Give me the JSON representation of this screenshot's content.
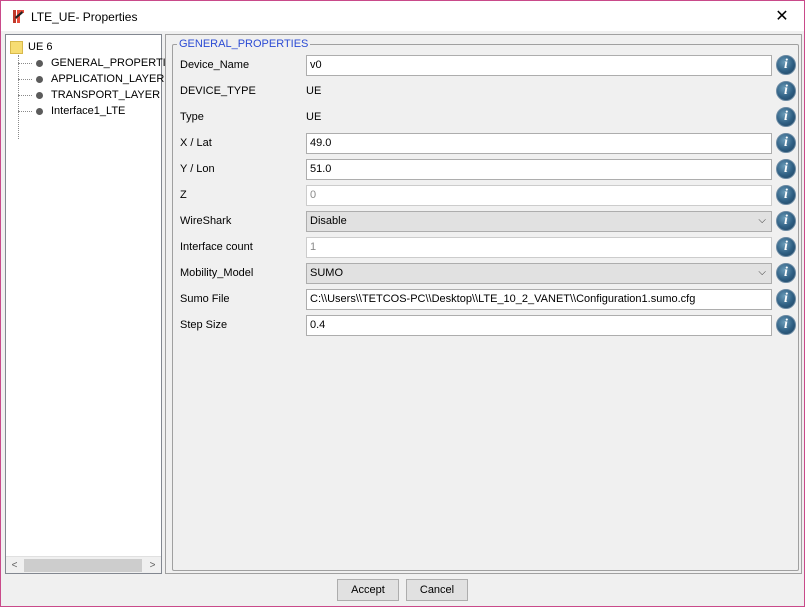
{
  "window": {
    "title": "LTE_UE- Properties",
    "close_glyph": "✕"
  },
  "tree": {
    "root": "UE 6",
    "items": [
      {
        "label": "GENERAL_PROPERTIES"
      },
      {
        "label": "APPLICATION_LAYER"
      },
      {
        "label": "TRANSPORT_LAYER"
      },
      {
        "label": "Interface1_LTE"
      }
    ]
  },
  "panel": {
    "group_title": "GENERAL_PROPERTIES",
    "fields": {
      "device_name": {
        "label": "Device_Name",
        "value": "v0"
      },
      "device_type": {
        "label": "DEVICE_TYPE",
        "value": "UE"
      },
      "type": {
        "label": "Type",
        "value": "UE"
      },
      "x_lat": {
        "label": "X / Lat",
        "value": "49.0"
      },
      "y_lon": {
        "label": "Y / Lon",
        "value": "51.0"
      },
      "z": {
        "label": "Z",
        "value": "0"
      },
      "wireshark": {
        "label": "WireShark",
        "value": "Disable"
      },
      "interface_count": {
        "label": "Interface count",
        "value": "1"
      },
      "mobility_model": {
        "label": "Mobility_Model",
        "value": "SUMO"
      },
      "sumo_file": {
        "label": "Sumo File",
        "value": "C:\\\\Users\\\\TETCOS-PC\\\\Desktop\\\\LTE_10_2_VANET\\\\Configuration1.sumo.cfg"
      },
      "step_size": {
        "label": "Step Size",
        "value": "0.4"
      }
    },
    "info_glyph": "i",
    "dropdown_glyph": "⌵"
  },
  "footer": {
    "accept_label": "Accept",
    "cancel_label": "Cancel"
  },
  "scroll": {
    "left_glyph": "<",
    "right_glyph": ">"
  },
  "colors": {
    "group_title": "#2b4bd4",
    "window_border": "#c94a8a"
  }
}
